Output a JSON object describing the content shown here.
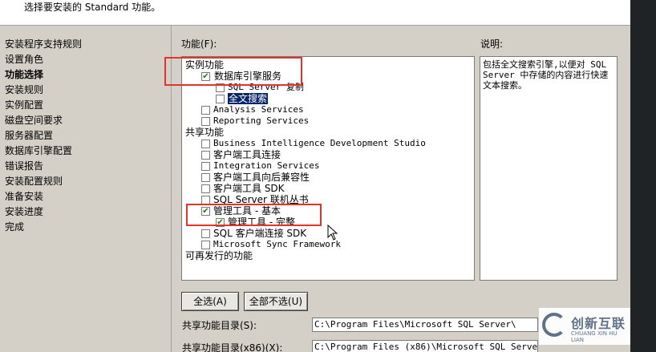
{
  "header": {
    "description": "选择要安装的 Standard 功能。"
  },
  "nav": {
    "items": [
      {
        "label": "安装程序支持规则",
        "active": false
      },
      {
        "label": "设置角色",
        "active": false
      },
      {
        "label": "功能选择",
        "active": true
      },
      {
        "label": "安装规则",
        "active": false
      },
      {
        "label": "实例配置",
        "active": false
      },
      {
        "label": "磁盘空间要求",
        "active": false
      },
      {
        "label": "服务器配置",
        "active": false
      },
      {
        "label": "数据库引擎配置",
        "active": false
      },
      {
        "label": "错误报告",
        "active": false
      },
      {
        "label": "安装配置规则",
        "active": false
      },
      {
        "label": "准备安装",
        "active": false
      },
      {
        "label": "安装进度",
        "active": false
      },
      {
        "label": "完成",
        "active": false
      }
    ]
  },
  "features": {
    "label": "功能(F):",
    "instance_heading": "实例功能",
    "db_engine": {
      "label": "数据库引擎服务",
      "checked": true
    },
    "sql_replication": {
      "label": "SQL Server 复制",
      "checked": false
    },
    "fulltext_search": {
      "label": "全文搜索",
      "checked": false,
      "selected": true
    },
    "analysis_services": {
      "label": "Analysis Services",
      "checked": false
    },
    "reporting_services": {
      "label": "Reporting Services",
      "checked": false
    },
    "shared_heading": "共享功能",
    "bids": {
      "label": "Business Intelligence Development Studio",
      "checked": false
    },
    "client_connectivity": {
      "label": "客户端工具连接",
      "checked": false
    },
    "integration_services": {
      "label": "Integration Services",
      "checked": false
    },
    "client_backcompat": {
      "label": "客户端工具向后兼容性",
      "checked": false
    },
    "client_sdk": {
      "label": "客户端工具 SDK",
      "checked": false
    },
    "books_online": {
      "label": "SQL Server 联机丛书",
      "checked": false
    },
    "mgmt_basic": {
      "label": "管理工具 - 基本",
      "checked": true
    },
    "mgmt_complete": {
      "label": "管理工具 - 完整",
      "checked": true
    },
    "sql_client_sdk": {
      "label": "SQL 客户端连接 SDK",
      "checked": false
    },
    "sync_framework": {
      "label": "Microsoft Sync Framework",
      "checked": false
    },
    "redistributable_heading": "可再发行的功能"
  },
  "description": {
    "label": "说明:",
    "text": "包括全文搜索引擎,以便对 SQL Server 中存储的内容进行快速文本搜索。"
  },
  "buttons": {
    "select_all": "全选(A)",
    "unselect_all": "全部不选(U)"
  },
  "paths": {
    "shared_dir_label": "共享功能目录(S):",
    "shared_dir_value": "C:\\Program Files\\Microsoft SQL Server\\",
    "shared_dir_x86_label": "共享功能目录(x86)(X):",
    "shared_dir_x86_value": "C:\\Program Files (x86)\\Microsoft SQL Server\\"
  },
  "watermark": {
    "name": "创新互联",
    "sub": "CHUANG XIN HU LIAN"
  },
  "colors": {
    "highlight_box": "#e3332b",
    "selection": "#0a246a",
    "checkmark": "#1b7a1b"
  }
}
